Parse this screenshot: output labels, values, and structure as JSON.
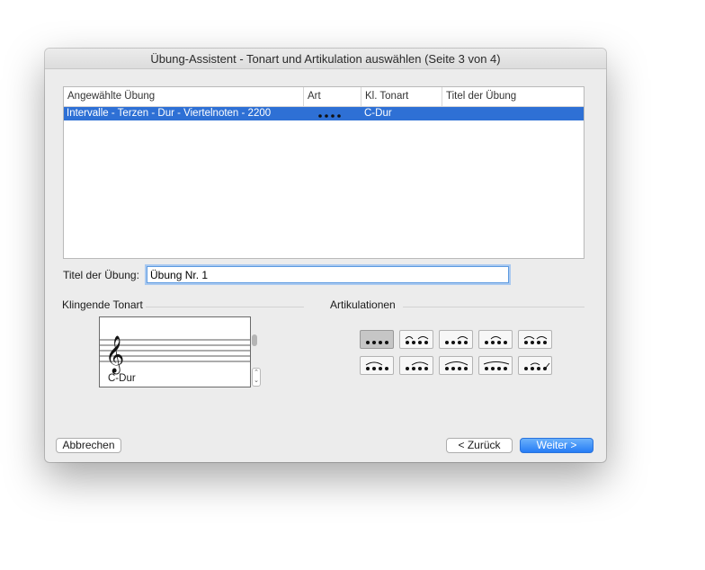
{
  "window": {
    "title": "Übung-Assistent - Tonart und Artikulation auswählen (Seite 3 von 4)"
  },
  "table": {
    "columns": [
      "Angewählte Übung",
      "Art",
      "Kl. Tonart",
      "Titel der Übung"
    ],
    "rows": [
      {
        "exercise": "Intervalle  - Terzen  - Dur  - Viertelnoten - 2200",
        "art_icon": "four-dots-icon",
        "key": "C-Dur",
        "title": ""
      }
    ]
  },
  "title_field": {
    "label": "Titel der Übung:",
    "value": "Übung Nr. 1"
  },
  "key_section": {
    "label": "Klingende Tonart",
    "selected": "C-Dur",
    "clef_icon": "treble-clef-icon"
  },
  "articulation_section": {
    "label": "Artikulationen",
    "buttons": [
      "four-dots-staccato-icon",
      "dot-three-slur-icon",
      "two-dots-two-slur-icon",
      "dot-two-slur-dot-icon",
      "two-slur-pairs-icon",
      "three-slur-dot-icon",
      "dot-three-slur-arc-icon",
      "four-slur-arc-icon",
      "dot-three-slur-long-icon",
      "three-dots-accent-icon"
    ],
    "selected_index": 0
  },
  "buttons": {
    "cancel": "Abbrechen",
    "back": "< Zurück",
    "next": "Weiter >"
  },
  "colors": {
    "selection": "#2e70d5",
    "primary_button": "#267cf5",
    "focus_ring": "#a9c9f0"
  }
}
